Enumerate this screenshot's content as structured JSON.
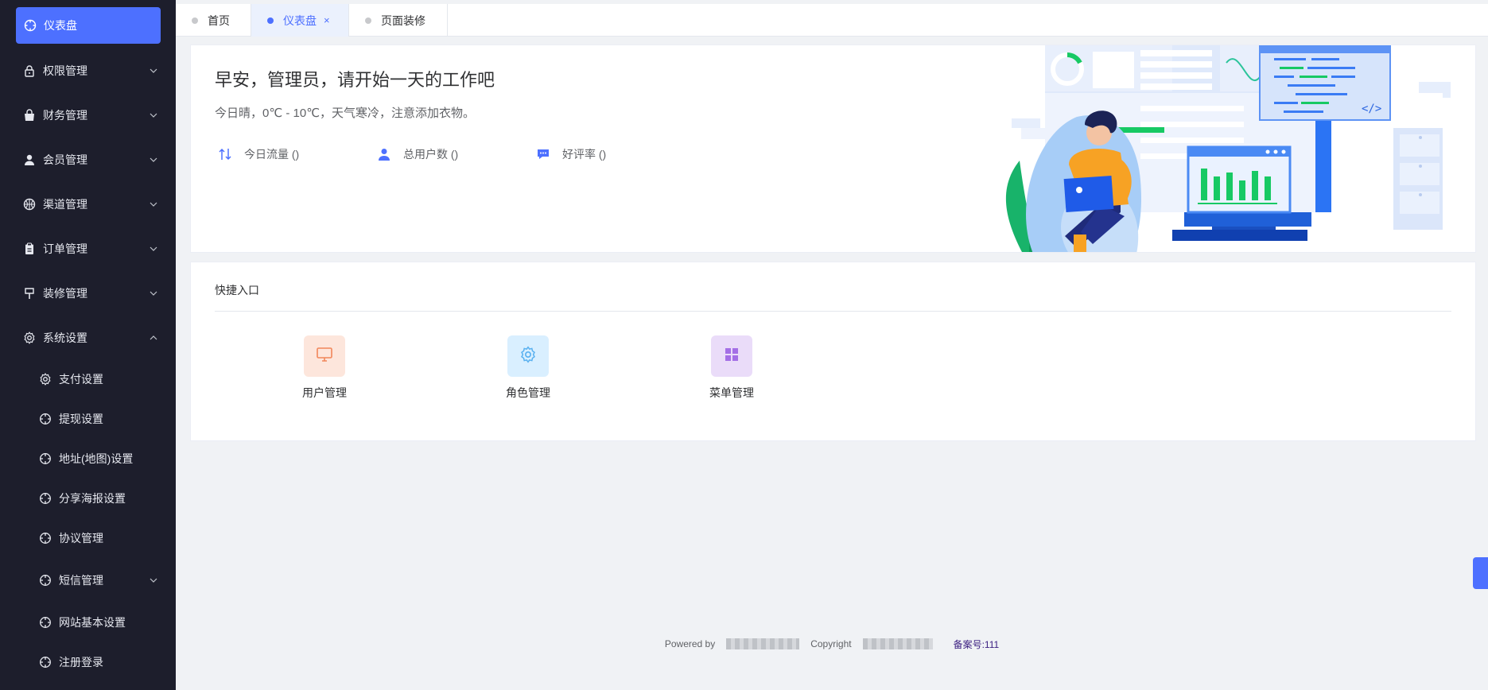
{
  "sidebar": {
    "items": [
      {
        "label": "仪表盘",
        "icon": "dashboard-icon",
        "active": true
      },
      {
        "label": "权限管理",
        "icon": "lock-icon"
      },
      {
        "label": "财务管理",
        "icon": "bag-icon"
      },
      {
        "label": "会员管理",
        "icon": "user-icon"
      },
      {
        "label": "渠道管理",
        "icon": "basketball-icon"
      },
      {
        "label": "订单管理",
        "icon": "clipboard-icon"
      },
      {
        "label": "装修管理",
        "icon": "brush-icon"
      },
      {
        "label": "系统设置",
        "icon": "gear-icon"
      }
    ],
    "sub_items": [
      {
        "label": "支付设置",
        "icon": "gear-icon"
      },
      {
        "label": "提现设置",
        "icon": "target-icon"
      },
      {
        "label": "地址(地图)设置",
        "icon": "target-icon"
      },
      {
        "label": "分享海报设置",
        "icon": "target-icon"
      },
      {
        "label": "协议管理",
        "icon": "target-icon"
      },
      {
        "label": "短信管理",
        "icon": "target-icon"
      },
      {
        "label": "网站基本设置",
        "icon": "target-icon"
      },
      {
        "label": "注册登录",
        "icon": "target-icon"
      }
    ]
  },
  "tabs": [
    {
      "label": "首页"
    },
    {
      "label": "仪表盘",
      "active": true,
      "close": "×"
    },
    {
      "label": "页面装修"
    }
  ],
  "welcome": {
    "greeting": "早安，管理员，请开始一天的工作吧",
    "weather": "今日晴，0℃ - 10℃，天气寒冷，注意添加衣物。",
    "stats": [
      {
        "label": "今日流量 ()",
        "icon": "traffic-icon"
      },
      {
        "label": "总用户数 ()",
        "icon": "user-icon"
      },
      {
        "label": "好评率 ()",
        "icon": "comment-icon"
      }
    ]
  },
  "quick": {
    "title": "快捷入口",
    "entries": [
      {
        "label": "用户管理",
        "icon": "monitor-icon",
        "bg": "#fde6dc",
        "color": "#f2865a"
      },
      {
        "label": "角色管理",
        "icon": "gear-icon",
        "bg": "#d9efff",
        "color": "#5ab1f0"
      },
      {
        "label": "菜单管理",
        "icon": "grid-icon",
        "bg": "#eadcf9",
        "color": "#a46fe6"
      }
    ]
  },
  "footer": {
    "powered": "Powered by",
    "copyright": "Copyright",
    "icp": "备案号:111"
  },
  "colors": {
    "sidebar_bg": "#1d1e2c",
    "accent": "#4d70ff",
    "page_bg": "#f0f2f5"
  }
}
